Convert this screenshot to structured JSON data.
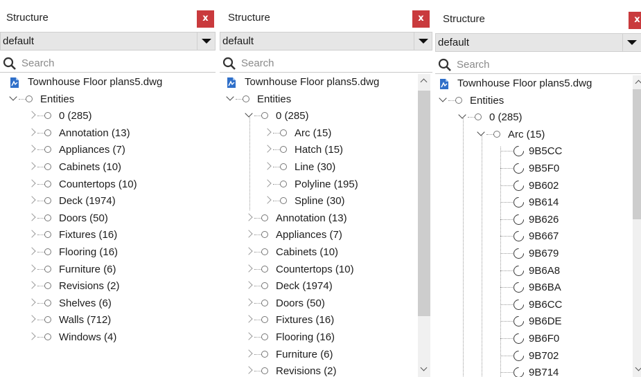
{
  "panels": [
    {
      "title": "Structure",
      "close_label": "x",
      "dropdown_value": "default",
      "search_placeholder": "Search",
      "root_file": "Townhouse Floor plans5.dwg",
      "entities_label": "Entities",
      "layers": [
        "0 (285)",
        "Annotation (13)",
        "Appliances (7)",
        "Cabinets (10)",
        "Countertops (10)",
        "Deck (1974)",
        "Doors (50)",
        "Fixtures (16)",
        "Flooring (16)",
        "Furniture (6)",
        "Revisions (2)",
        "Shelves (6)",
        "Walls (712)",
        "Windows (4)"
      ]
    },
    {
      "title": "Structure",
      "close_label": "x",
      "dropdown_value": "default",
      "search_placeholder": "Search",
      "root_file": "Townhouse Floor plans5.dwg",
      "entities_label": "Entities",
      "layer0_label": "0 (285)",
      "layer0_children": [
        "Arc (15)",
        "Hatch (15)",
        "Line (30)",
        "Polyline (195)",
        "Spline (30)"
      ],
      "layers": [
        "Annotation (13)",
        "Appliances (7)",
        "Cabinets (10)",
        "Countertops (10)",
        "Deck (1974)",
        "Doors (50)",
        "Fixtures (16)",
        "Flooring (16)",
        "Furniture (6)",
        "Revisions (2)"
      ]
    },
    {
      "title": "Structure",
      "close_label": "x",
      "dropdown_value": "default",
      "search_placeholder": "Search",
      "root_file": "Townhouse Floor plans5.dwg",
      "entities_label": "Entities",
      "layer0_label": "0 (285)",
      "arc_label": "Arc (15)",
      "arc_items": [
        "9B5CC",
        "9B5F0",
        "9B602",
        "9B614",
        "9B626",
        "9B667",
        "9B679",
        "9B6A8",
        "9B6BA",
        "9B6CC",
        "9B6DE",
        "9B6F0",
        "9B702",
        "9B714"
      ]
    }
  ],
  "colors": {
    "close_bg": "#c93a3d",
    "dropdown_bg": "#e6e6e6",
    "file_icon": "#2f6fc9"
  }
}
